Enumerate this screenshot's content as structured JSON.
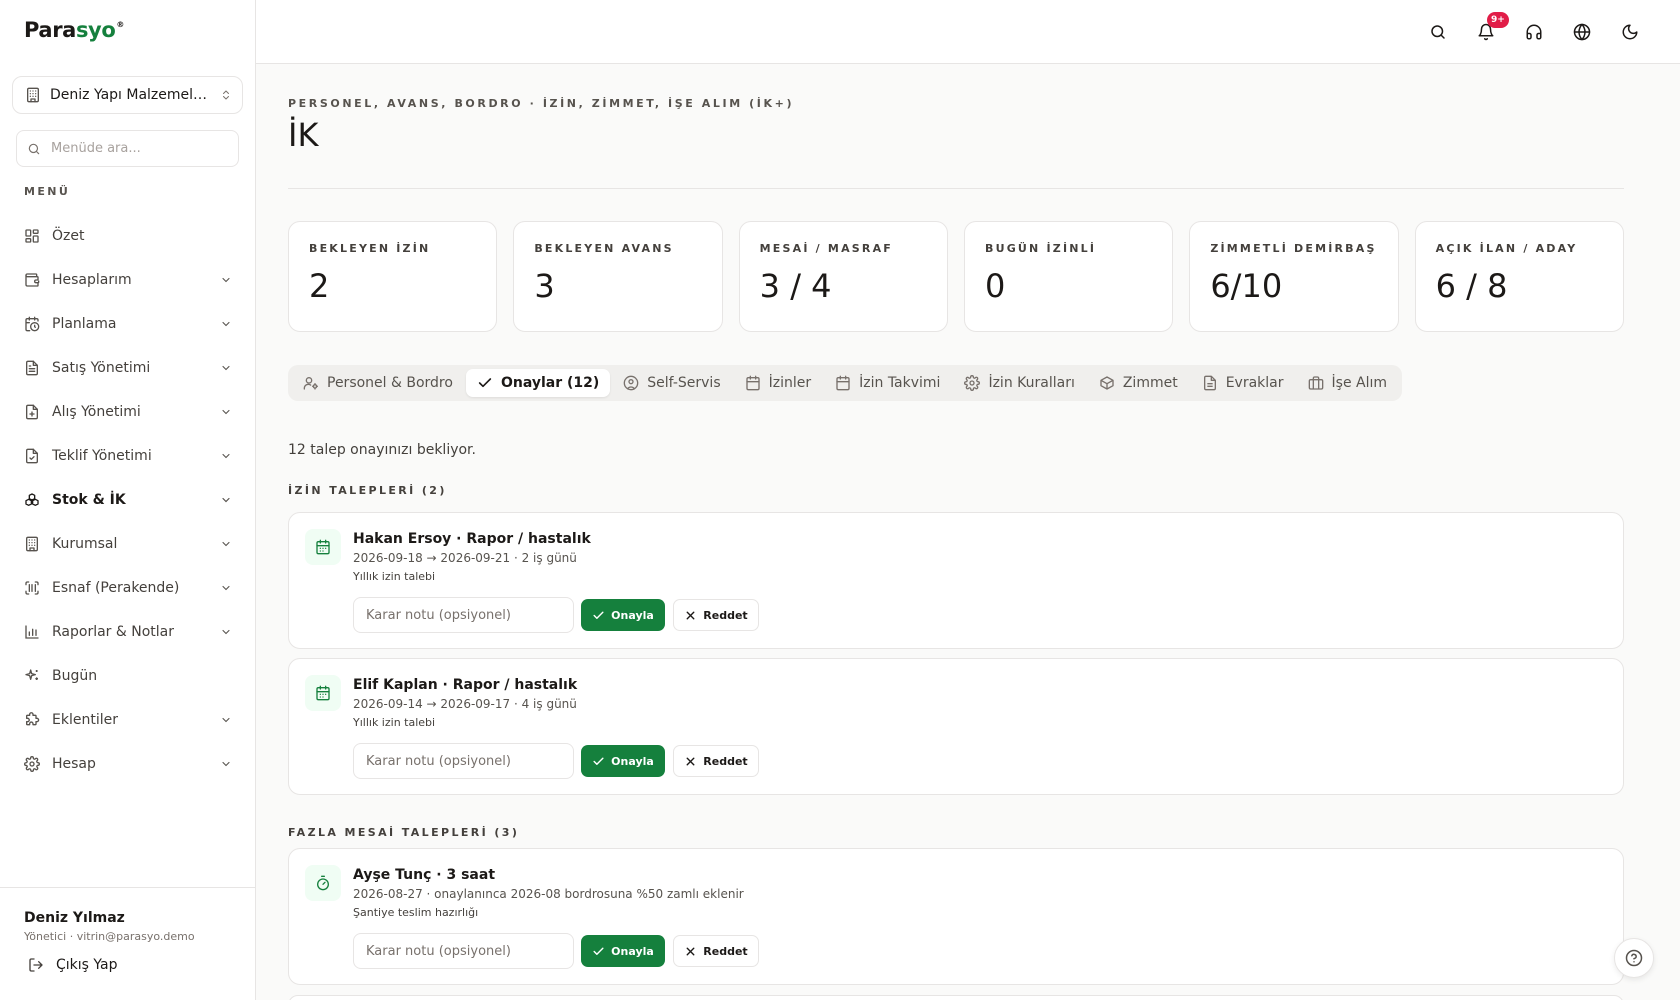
{
  "brand": {
    "name_part1": "Para",
    "name_part2": "syo",
    "reg": "®",
    "accent": "#15803d"
  },
  "sidebar": {
    "company": "Deniz Yapı Malzemeleri...",
    "search_placeholder": "Menüde ara...",
    "menu_label": "MENÜ",
    "items": [
      {
        "label": "Özet",
        "icon": "dashboard-icon",
        "has_children": false
      },
      {
        "label": "Hesaplarım",
        "icon": "wallet-icon",
        "has_children": true
      },
      {
        "label": "Planlama",
        "icon": "calendar-clock-icon",
        "has_children": true
      },
      {
        "label": "Satış Yönetimi",
        "icon": "receipt-icon",
        "has_children": true
      },
      {
        "label": "Alış Yönetimi",
        "icon": "file-plus-icon",
        "has_children": true
      },
      {
        "label": "Teklif Yönetimi",
        "icon": "file-check-icon",
        "has_children": true
      },
      {
        "label": "Stok & İK",
        "icon": "boxes-icon",
        "has_children": true,
        "active": true
      },
      {
        "label": "Kurumsal",
        "icon": "building-icon",
        "has_children": true
      },
      {
        "label": "Esnaf (Perakende)",
        "icon": "scan-barcode-icon",
        "has_children": true
      },
      {
        "label": "Raporlar & Notlar",
        "icon": "bar-chart-icon",
        "has_children": true
      },
      {
        "label": "Bugün",
        "icon": "sparkles-icon",
        "has_children": false
      },
      {
        "label": "Eklentiler",
        "icon": "puzzle-icon",
        "has_children": true
      },
      {
        "label": "Hesap",
        "icon": "gear-icon",
        "has_children": true
      }
    ],
    "user": {
      "name": "Deniz Yılmaz",
      "meta": "Yönetici · vitrin@parasyo.demo"
    },
    "logout_label": "Çıkış Yap"
  },
  "topbar": {
    "notification_badge": "9+"
  },
  "page": {
    "eyebrow": "PERSONEL, AVANS, BORDRO · İZİN, ZİMMET, İŞE ALIM (İK+)",
    "title": "İK"
  },
  "stats": [
    {
      "label": "BEKLEYEN İZİN",
      "value": "2"
    },
    {
      "label": "BEKLEYEN AVANS",
      "value": "3"
    },
    {
      "label": "MESAİ / MASRAF",
      "value": "3 / 4"
    },
    {
      "label": "BUGÜN İZİNLİ",
      "value": "0"
    },
    {
      "label": "ZİMMETLİ DEMİRBAŞ",
      "value": "6/10"
    },
    {
      "label": "AÇIK İLAN / ADAY",
      "value": "6 / 8"
    }
  ],
  "tabs": [
    {
      "label": "Personel & Bordro",
      "icon": "user-cog-icon"
    },
    {
      "label": "Onaylar (12)",
      "icon": "check-icon",
      "active": true
    },
    {
      "label": "Self-Servis",
      "icon": "user-circle-icon"
    },
    {
      "label": "İzinler",
      "icon": "calendar-icon"
    },
    {
      "label": "İzin Takvimi",
      "icon": "calendar-icon"
    },
    {
      "label": "İzin Kuralları",
      "icon": "gear-icon"
    },
    {
      "label": "Zimmet",
      "icon": "package-icon"
    },
    {
      "label": "Evraklar",
      "icon": "file-icon"
    },
    {
      "label": "İşe Alım",
      "icon": "briefcase-icon"
    }
  ],
  "approvals": {
    "summary": "12 talep onayınızı bekliyor.",
    "decision_placeholder": "Karar notu (opsiyonel)",
    "approve_label": "Onayla",
    "reject_label": "Reddet",
    "leave_section": "İZİN TALEPLERİ (2)",
    "leave_requests": [
      {
        "title": "Hakan Ersoy · Rapor / hastalık",
        "meta": "2026-09-18 → 2026-09-21 · 2 iş günü",
        "note": "Yıllık izin talebi"
      },
      {
        "title": "Elif Kaplan · Rapor / hastalık",
        "meta": "2026-09-14 → 2026-09-17 · 4 iş günü",
        "note": "Yıllık izin talebi"
      }
    ],
    "overtime_section": "FAZLA MESAİ TALEPLERİ (3)",
    "overtime_requests": [
      {
        "title": "Ayşe Tunç · 3 saat",
        "meta": "2026-08-27 · onaylanınca 2026-08 bordrosuna %50 zamlı eklenir",
        "note": "Şantiye teslim hazırlığı"
      }
    ]
  }
}
